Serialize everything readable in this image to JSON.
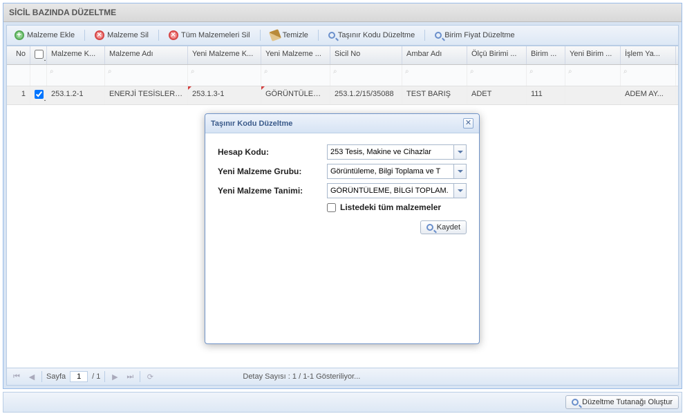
{
  "panel": {
    "title": "SİCİL BAZINDA DÜZELTME"
  },
  "toolbar": {
    "add": "Malzeme Ekle",
    "del": "Malzeme Sil",
    "delAll": "Tüm Malzemeleri Sil",
    "clean": "Temizle",
    "codeFix": "Taşınır Kodu Düzeltme",
    "priceFix": "Birim Fiyat Düzeltme"
  },
  "columns": {
    "no": "No",
    "malzk": "Malzeme K...",
    "malza": "Malzeme Adı",
    "ymalzk": "Yeni Malzeme K...",
    "ymalza": "Yeni Malzeme ...",
    "sicil": "Sicil No",
    "ambar": "Ambar Adı",
    "olcu": "Ölçü Birimi ...",
    "birim": "Birim ...",
    "ybirim": "Yeni Birim ...",
    "islem": "İşlem Ya..."
  },
  "row": {
    "no": "1",
    "malzk": "253.1.2-1",
    "malza": "ENERJİ TESİSLERİ (TE...",
    "ymalzk": "253.1.3-1",
    "ymalza": "GÖRÜNTÜLEME...",
    "sicil": "253.1.2/15/35088",
    "ambar": "TEST BARIŞ",
    "olcu": "ADET",
    "birim": "111",
    "ybirim": "",
    "islem": "ADEM AY..."
  },
  "paging": {
    "pageLabel": "Sayfa",
    "page": "1",
    "totalSep": "/ 1",
    "status": "Detay Sayısı : 1 / 1-1 Gösteriliyor..."
  },
  "footer": {
    "create": "Düzeltme Tutanağı Oluştur"
  },
  "modal": {
    "title": "Taşınır Kodu Düzeltme",
    "hesapKoduLabel": "Hesap Kodu:",
    "hesapKoduValue": "253 Tesis, Makine ve Cihazlar",
    "yeniGrupLabel": "Yeni Malzeme Grubu:",
    "yeniGrupValue": "Görüntüleme, Bilgi Toplama ve T",
    "yeniTanimLabel": "Yeni Malzeme Tanimi:",
    "yeniTanimValue": "GÖRÜNTÜLEME, BİLGİ TOPLAM.",
    "checkLabel": "Listedeki tüm malzemeler",
    "save": "Kaydet"
  }
}
